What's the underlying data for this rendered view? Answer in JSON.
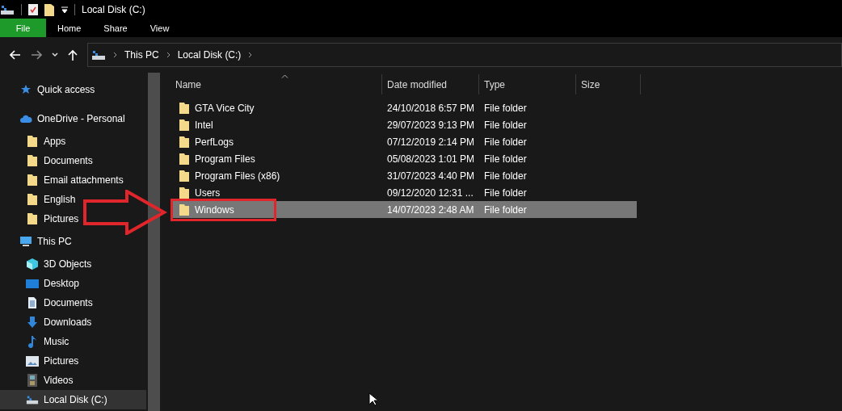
{
  "window": {
    "title": "Local Disk (C:)"
  },
  "ribbon_tabs": [
    {
      "label": "File",
      "selected": true
    },
    {
      "label": "Home",
      "selected": false
    },
    {
      "label": "Share",
      "selected": false
    },
    {
      "label": "View",
      "selected": false
    }
  ],
  "address_bar": {
    "crumbs": [
      "This PC",
      "Local Disk (C:)"
    ]
  },
  "sidebar": {
    "items": [
      {
        "label": "Quick access",
        "kind": "star",
        "selected": false
      },
      {
        "label": "OneDrive - Personal",
        "kind": "cloud",
        "selected": false,
        "children": [
          {
            "label": "Apps",
            "kind": "folder",
            "selected": false
          },
          {
            "label": "Documents",
            "kind": "folder",
            "selected": false
          },
          {
            "label": "Email attachments",
            "kind": "folder",
            "selected": false
          },
          {
            "label": "English",
            "kind": "folder",
            "selected": false
          },
          {
            "label": "Pictures",
            "kind": "folder",
            "selected": false
          }
        ]
      },
      {
        "label": "This PC",
        "kind": "pc",
        "selected": false,
        "children": [
          {
            "label": "3D Objects",
            "kind": "objects",
            "selected": false
          },
          {
            "label": "Desktop",
            "kind": "desktop",
            "selected": false
          },
          {
            "label": "Documents",
            "kind": "documents",
            "selected": false
          },
          {
            "label": "Downloads",
            "kind": "downloads",
            "selected": false
          },
          {
            "label": "Music",
            "kind": "music",
            "selected": false
          },
          {
            "label": "Pictures",
            "kind": "pictures",
            "selected": false
          },
          {
            "label": "Videos",
            "kind": "videos",
            "selected": false
          },
          {
            "label": "Local Disk (C:)",
            "kind": "drive",
            "selected": true
          }
        ]
      }
    ]
  },
  "table": {
    "columns": [
      "Name",
      "Date modified",
      "Type",
      "Size"
    ],
    "rows": [
      {
        "name": "GTA Vice City",
        "date": "24/10/2018 6:57 PM",
        "type": "File folder",
        "selected": false,
        "highlighted": false
      },
      {
        "name": "Intel",
        "date": "29/07/2023 9:13 PM",
        "type": "File folder",
        "selected": false,
        "highlighted": false
      },
      {
        "name": "PerfLogs",
        "date": "07/12/2019 2:14 PM",
        "type": "File folder",
        "selected": false,
        "highlighted": false
      },
      {
        "name": "Program Files",
        "date": "05/08/2023 1:01 PM",
        "type": "File folder",
        "selected": false,
        "highlighted": false
      },
      {
        "name": "Program Files (x86)",
        "date": "31/07/2023 4:40 PM",
        "type": "File folder",
        "selected": false,
        "highlighted": false
      },
      {
        "name": "Users",
        "date": "09/12/2020 12:31 ...",
        "type": "File folder",
        "selected": false,
        "highlighted": false
      },
      {
        "name": "Windows",
        "date": "14/07/2023 2:48 AM",
        "type": "File folder",
        "selected": true,
        "highlighted": true
      }
    ]
  }
}
